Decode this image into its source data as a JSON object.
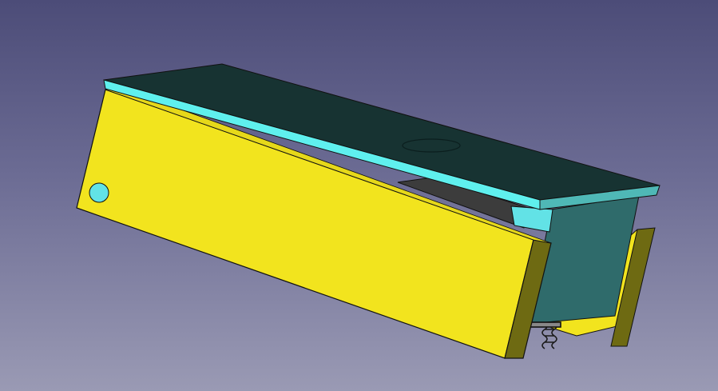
{
  "viewport": {
    "background_top": "#4c4c78",
    "background_bottom": "#9a9ab4"
  },
  "model": {
    "colors": {
      "yellow_face": "#f2e41e",
      "yellow_edge": "#6e6a12",
      "lid_top": "#173332",
      "lid_edge": "#5ff0ee",
      "box_side": "#2f6b6b",
      "box_front": "#2a5e5e",
      "hole": "#62e2e6",
      "spring": "#1a1a1a"
    }
  }
}
